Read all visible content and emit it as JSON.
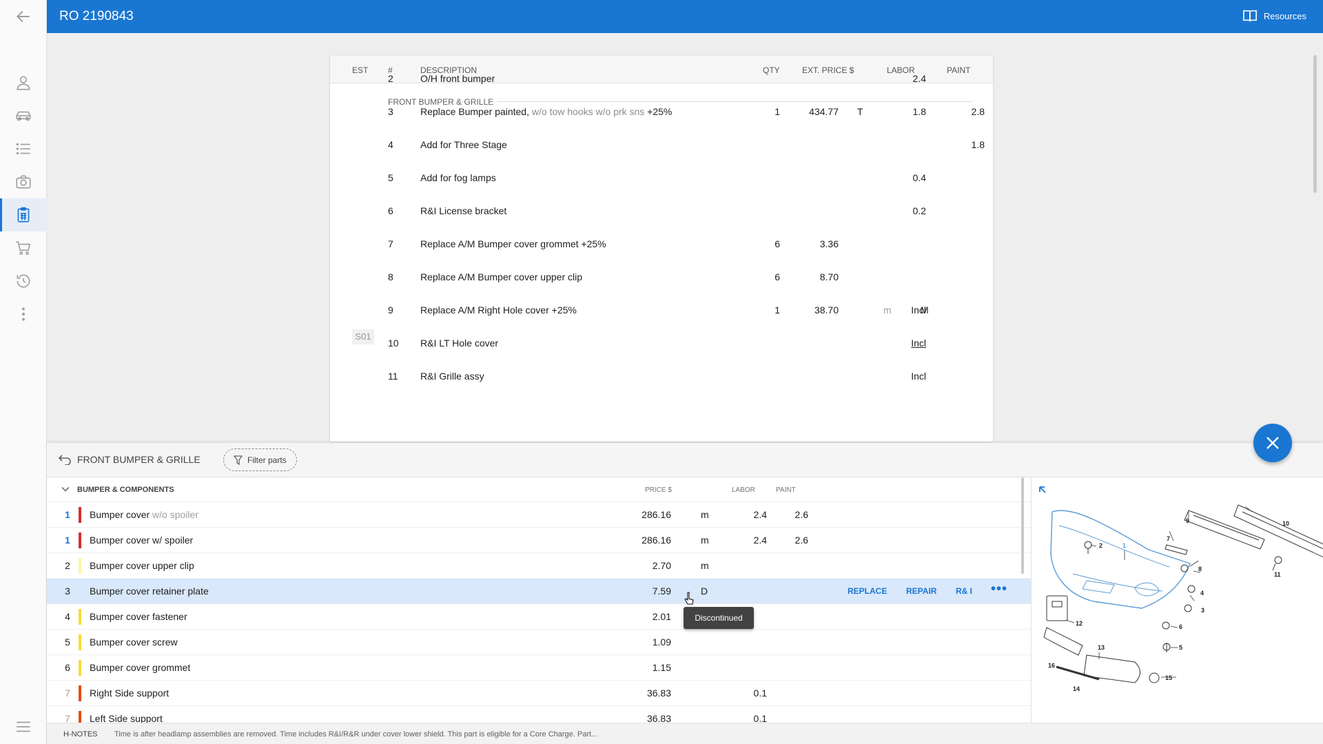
{
  "topbar": {
    "title": "RO 2190843",
    "resources_label": "Resources"
  },
  "sidebar": {
    "items": [
      {
        "name": "back-arrow-icon"
      },
      {
        "name": "person-icon"
      },
      {
        "name": "car-icon"
      },
      {
        "name": "list-icon"
      },
      {
        "name": "camera-icon"
      },
      {
        "name": "clipboard-icon"
      },
      {
        "name": "cart-icon"
      },
      {
        "name": "history-icon"
      },
      {
        "name": "more-vertical-icon"
      },
      {
        "name": "menu-icon"
      }
    ],
    "active": "clipboard-icon"
  },
  "estimate": {
    "columns": {
      "est": "EST",
      "num": "#",
      "description": "DESCRIPTION",
      "qty": "QTY",
      "ext_price": "EXT. PRICE $",
      "labor": "LABOR",
      "paint": "PAINT"
    },
    "section_title": "FRONT BUMPER & GRILLE",
    "rows": [
      {
        "est": "",
        "num": "2",
        "desc": "O/H front bumper",
        "desc_muted": "",
        "desc_suffix": "",
        "qty": "",
        "price": "",
        "price_type": "",
        "labor_prefix": "",
        "labor": "2.4",
        "labor_suffix": "",
        "paint": ""
      },
      {
        "est": "",
        "num": "3",
        "desc": "Replace Bumper painted,",
        "desc_muted": " w/o tow hooks w/o prk sns",
        "desc_suffix": " +25%",
        "qty": "1",
        "price": "434.77",
        "price_type": "T",
        "labor_prefix": "",
        "labor": "1.8",
        "labor_suffix": "",
        "paint": "2.8"
      },
      {
        "est": "",
        "num": "4",
        "desc": "Add for Three Stage",
        "desc_muted": "",
        "desc_suffix": "",
        "qty": "",
        "price": "",
        "price_type": "",
        "labor_prefix": "",
        "labor": "",
        "labor_suffix": "",
        "paint": "1.8"
      },
      {
        "est": "",
        "num": "5",
        "desc": "Add for fog lamps",
        "desc_muted": "",
        "desc_suffix": "",
        "qty": "",
        "price": "",
        "price_type": "",
        "labor_prefix": "",
        "labor": "0.4",
        "labor_suffix": "",
        "paint": ""
      },
      {
        "est": "",
        "num": "6",
        "desc": "R&I License bracket",
        "desc_muted": "",
        "desc_suffix": "",
        "qty": "",
        "price": "",
        "price_type": "",
        "labor_prefix": "",
        "labor": "0.2",
        "labor_suffix": "",
        "paint": ""
      },
      {
        "est": "",
        "num": "7",
        "desc": "Replace A/M Bumper cover grommet +25%",
        "desc_muted": "",
        "desc_suffix": "",
        "qty": "6",
        "price": "3.36",
        "price_type": "",
        "labor_prefix": "",
        "labor": "",
        "labor_suffix": "",
        "paint": ""
      },
      {
        "est": "",
        "num": "8",
        "desc": "Replace A/M Bumper cover upper clip",
        "desc_muted": "",
        "desc_suffix": "",
        "qty": "6",
        "price": "8.70",
        "price_type": "",
        "labor_prefix": "",
        "labor": "",
        "labor_suffix": "",
        "paint": ""
      },
      {
        "est": "",
        "num": "9",
        "desc": "Replace A/M Right Hole cover +25%",
        "desc_muted": "",
        "desc_suffix": "",
        "qty": "1",
        "price": "38.70",
        "price_type": "",
        "labor_prefix": "m",
        "labor": "Incl",
        "labor_suffix": "M",
        "paint": ""
      },
      {
        "est": "S01",
        "num": "10",
        "desc": "R&I LT Hole cover",
        "desc_muted": "",
        "desc_suffix": "",
        "qty": "",
        "price": "",
        "price_type": "",
        "labor_prefix": "",
        "labor": "Incl",
        "labor_suffix": "",
        "paint": ""
      },
      {
        "est": "",
        "num": "11",
        "desc": "R&I Grille assy",
        "desc_muted": "",
        "desc_suffix": "",
        "qty": "",
        "price": "",
        "price_type": "",
        "labor_prefix": "",
        "labor": "Incl",
        "labor_suffix": "",
        "paint": ""
      }
    ]
  },
  "parts_panel": {
    "section": "FRONT BUMPER & GRILLE",
    "filter_label": "Filter parts",
    "group": "BUMPER & COMPONENTS",
    "columns": {
      "price": "PRICE $",
      "labor": "LABOR",
      "paint": "PAINT"
    },
    "rows": [
      {
        "num": "1",
        "num_style": "blue",
        "bar": "#d32f2f",
        "name": "Bumper cover",
        "name_muted": " w/o spoiler",
        "price": "286.16",
        "type": "m",
        "labor": "2.4",
        "paint": "2.6"
      },
      {
        "num": "1",
        "num_style": "blue",
        "bar": "#d32f2f",
        "name": "Bumper cover w/ spoiler",
        "name_muted": "",
        "price": "286.16",
        "type": "m",
        "labor": "2.4",
        "paint": "2.6"
      },
      {
        "num": "2",
        "num_style": "",
        "bar": "#fff59d",
        "name": "Bumper cover upper clip",
        "name_muted": "",
        "price": "2.70",
        "type": "m",
        "labor": "",
        "paint": ""
      },
      {
        "num": "3",
        "num_style": "",
        "bar": "",
        "name": "Bumper cover retainer plate",
        "name_muted": "",
        "price": "7.59",
        "type": "D",
        "labor": "",
        "paint": "",
        "selected": true
      },
      {
        "num": "4",
        "num_style": "",
        "bar": "#fdd835",
        "name": "Bumper cover fastener",
        "name_muted": "",
        "price": "2.01",
        "type": "",
        "labor": "",
        "paint": ""
      },
      {
        "num": "5",
        "num_style": "",
        "bar": "#fdd835",
        "name": "Bumper cover screw",
        "name_muted": "",
        "price": "1.09",
        "type": "",
        "labor": "",
        "paint": ""
      },
      {
        "num": "6",
        "num_style": "",
        "bar": "#fdd835",
        "name": "Bumper cover grommet",
        "name_muted": "",
        "price": "1.15",
        "type": "",
        "labor": "",
        "paint": ""
      },
      {
        "num": "7",
        "num_style": "grey",
        "bar": "#e64a19",
        "name": "Right Side support",
        "name_muted": "",
        "price": "36.83",
        "type": "",
        "labor": "0.1",
        "paint": ""
      },
      {
        "num": "7",
        "num_style": "grey",
        "bar": "#e64a19",
        "name": "Left Side support",
        "name_muted": "",
        "price": "36.83",
        "type": "",
        "labor": "0.1",
        "paint": ""
      }
    ],
    "row_actions": {
      "replace": "REPLACE",
      "repair": "REPAIR",
      "ri": "R& I",
      "more": "•••"
    },
    "tooltip": "Discontinued"
  },
  "diagram": {
    "callouts": [
      "1",
      "2",
      "3",
      "4",
      "5",
      "6",
      "7",
      "8",
      "9",
      "10",
      "11",
      "12",
      "13",
      "14",
      "15",
      "16"
    ],
    "highlight_color": "#5b9bd5"
  },
  "notes": {
    "label": "H-NOTES",
    "text": "Time is after headlamp assemblies are removed. Time includes R&I/R&R under cover lower shield. This part is eligible for a Core Charge. Part..."
  },
  "colors": {
    "primary": "#1976d2",
    "selected_row": "#d9e8fa"
  }
}
